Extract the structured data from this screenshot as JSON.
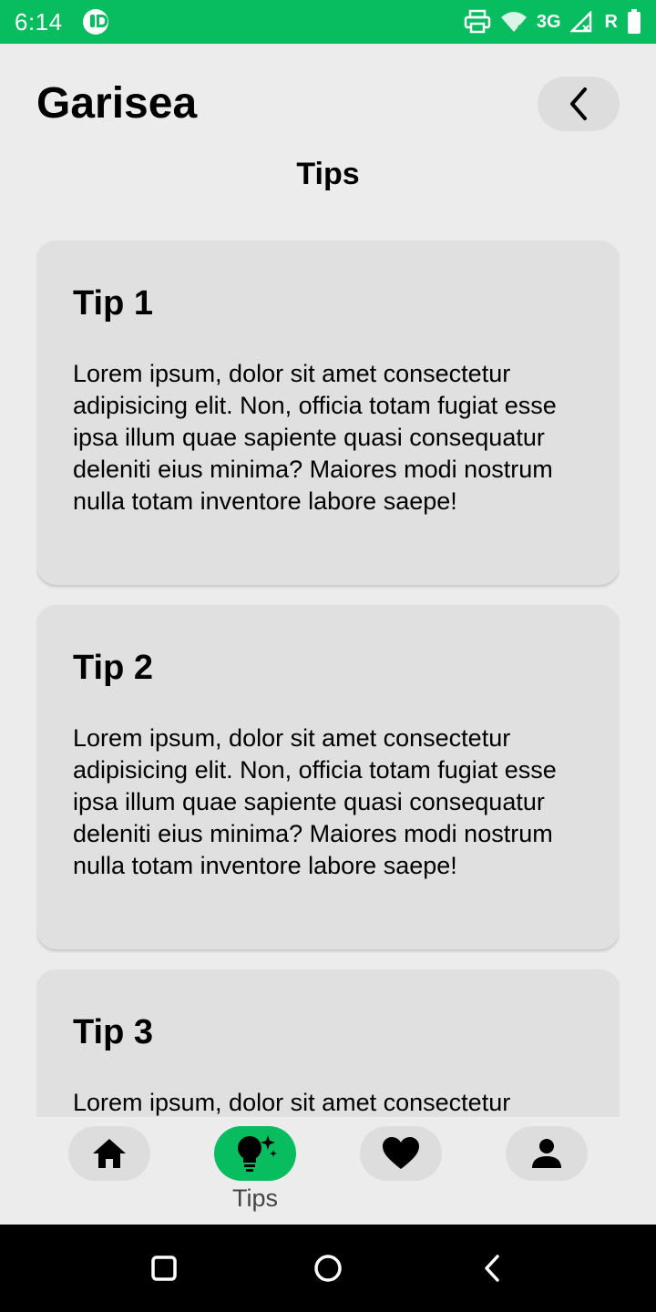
{
  "status_bar": {
    "time": "6:14",
    "network": "3G",
    "carrier_flag": "R",
    "icons": [
      "app-notification-icon",
      "print-icon",
      "wifi-icon",
      "signal-icon",
      "battery-icon"
    ]
  },
  "header": {
    "app_title": "Garisea",
    "page_title": "Tips"
  },
  "tips": [
    {
      "title": "Tip 1",
      "body": "Lorem ipsum, dolor sit amet consectetur adipisicing elit. Non, officia totam fugiat esse ipsa illum quae sapiente quasi consequatur deleniti eius minima? Maiores modi nostrum nulla totam inventore labore saepe!"
    },
    {
      "title": "Tip 2",
      "body": "Lorem ipsum, dolor sit amet consectetur adipisicing elit. Non, officia totam fugiat esse ipsa illum quae sapiente quasi consequatur deleniti eius minima? Maiores modi nostrum nulla totam inventore labore saepe!"
    },
    {
      "title": "Tip 3",
      "body": "Lorem ipsum, dolor sit amet consectetur"
    }
  ],
  "bottom_nav": {
    "items": [
      {
        "id": "home",
        "icon": "home-icon",
        "active": false
      },
      {
        "id": "tips",
        "icon": "lightbulb-icon",
        "active": true
      },
      {
        "id": "favorites",
        "icon": "heart-icon",
        "active": false
      },
      {
        "id": "profile",
        "icon": "person-icon",
        "active": false
      }
    ],
    "active_label": "Tips"
  },
  "colors": {
    "accent": "#07bd5f",
    "background": "#ececec",
    "card": "#e0e0e0",
    "pill": "#dddddd"
  }
}
